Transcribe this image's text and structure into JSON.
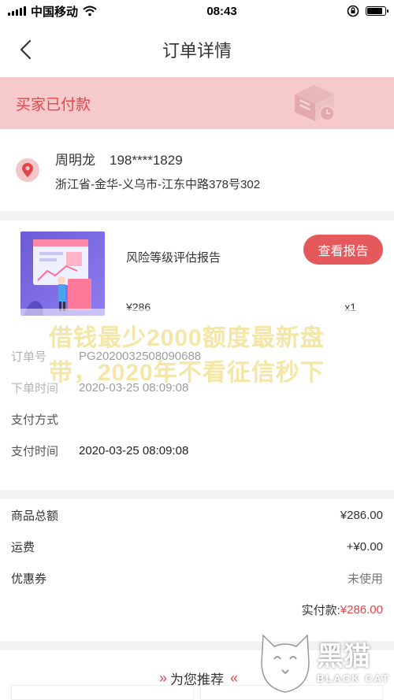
{
  "status_bar": {
    "carrier": "中国移动",
    "time": "08:43",
    "battery_level": 0.85
  },
  "nav": {
    "title": "订单详情"
  },
  "status_banner": {
    "text": "买家已付款"
  },
  "address": {
    "name": "周明龙",
    "phone": "198****1829",
    "detail": "浙江省-金华-义乌市-江东中路378号302"
  },
  "product": {
    "name": "风险等级评估报告",
    "button_label": "查看报告",
    "price": "¥286",
    "quantity": "x1"
  },
  "order_info": {
    "rows": [
      {
        "label": "订单号",
        "value": "PG2020032508090688"
      },
      {
        "label": "下单时间",
        "value": "2020-03-25 08:09:08"
      },
      {
        "label": "支付方式",
        "value": ""
      },
      {
        "label": "支付时间",
        "value": "2020-03-25 08:09:08"
      }
    ]
  },
  "watermark": {
    "line1": "借钱最少2000额度最新盘",
    "line2": "带，2020年不看征信秒下"
  },
  "amounts": {
    "rows": [
      {
        "label": "商品总额",
        "value": "¥286.00"
      },
      {
        "label": "运费",
        "value": "+¥0.00"
      },
      {
        "label": "优惠券",
        "value": "未使用"
      }
    ],
    "paid_label": "实付款:",
    "paid_value": "¥286.00"
  },
  "recommend": {
    "title": "为您推荐"
  },
  "logo": {
    "cn": "黑猫",
    "en": "BLACK CAT"
  },
  "colors": {
    "accent": "#e0474b",
    "banner_bg": "#f6c9cb",
    "button_bg": "#e5585b"
  }
}
